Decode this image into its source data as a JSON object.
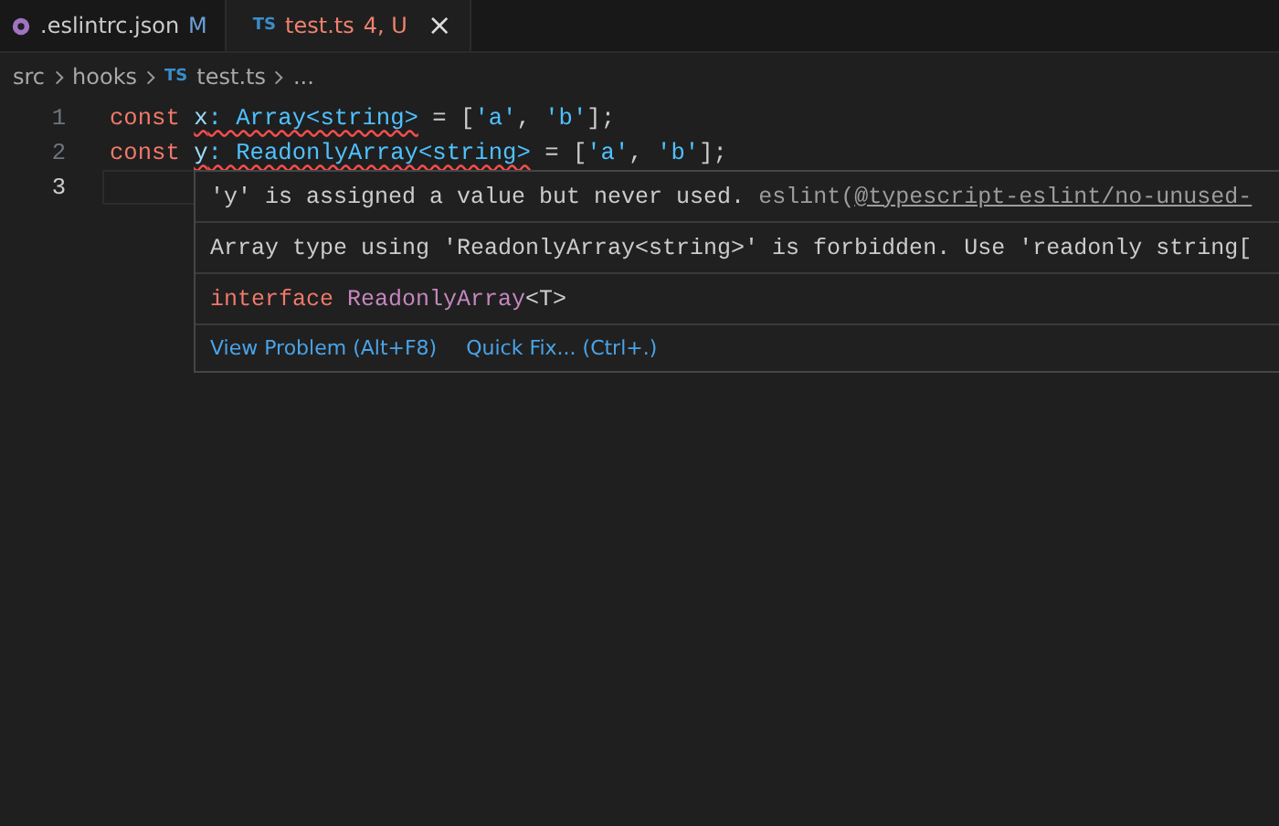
{
  "tabs": [
    {
      "kind": "json",
      "label": ".eslintrc.json",
      "badge": "M",
      "selected": false,
      "has_errors": false
    },
    {
      "kind": "ts",
      "icon": "TS",
      "label": "test.ts",
      "badge": "4, U",
      "selected": true,
      "has_errors": true
    }
  ],
  "close_icon": "×",
  "breadcrumbs": [
    {
      "label": "src"
    },
    {
      "label": "hooks"
    },
    {
      "label": "test.ts",
      "icon": "TS"
    },
    {
      "label": "..."
    }
  ],
  "code_lines": [
    {
      "number": "1",
      "active": false,
      "tokens": [
        {
          "kind": "keyword",
          "text": "const "
        },
        {
          "kind": "variable",
          "text": "x",
          "squiggle": true
        },
        {
          "kind": "type",
          "text": ": Array<string>",
          "squiggle": true
        },
        {
          "kind": "plain",
          "text": " = ["
        },
        {
          "kind": "string",
          "text": "'a'"
        },
        {
          "kind": "plain",
          "text": ", "
        },
        {
          "kind": "string",
          "text": "'b'"
        },
        {
          "kind": "plain",
          "text": "];"
        }
      ]
    },
    {
      "number": "2",
      "active": false,
      "tokens": [
        {
          "kind": "keyword",
          "text": "const "
        },
        {
          "kind": "variable",
          "text": "y",
          "squiggle": true
        },
        {
          "kind": "type",
          "text": ": ReadonlyArray<string>",
          "squiggle": true
        },
        {
          "kind": "plain",
          "text": " = ["
        },
        {
          "kind": "string",
          "text": "'a'"
        },
        {
          "kind": "plain",
          "text": ", "
        },
        {
          "kind": "string",
          "text": "'b'"
        },
        {
          "kind": "plain",
          "text": "];"
        }
      ]
    },
    {
      "number": "3",
      "active": true
    }
  ],
  "hover": {
    "problems": [
      {
        "message": "'y' is assigned a value but never used.",
        "source": "eslint(",
        "rule_link": "@typescript-eslint/no-unused-"
      },
      {
        "message": "Array type using 'ReadonlyArray<string>' is forbidden. Use 'readonly string["
      }
    ],
    "signature": [
      {
        "kind": "keyword",
        "text": "interface "
      },
      {
        "kind": "interface",
        "text": "ReadonlyArray"
      },
      {
        "kind": "plain",
        "text": "<T>"
      }
    ],
    "actions": [
      {
        "label": "View Problem (Alt+F8)"
      },
      {
        "label": "Quick Fix... (Ctrl+.)"
      }
    ]
  }
}
